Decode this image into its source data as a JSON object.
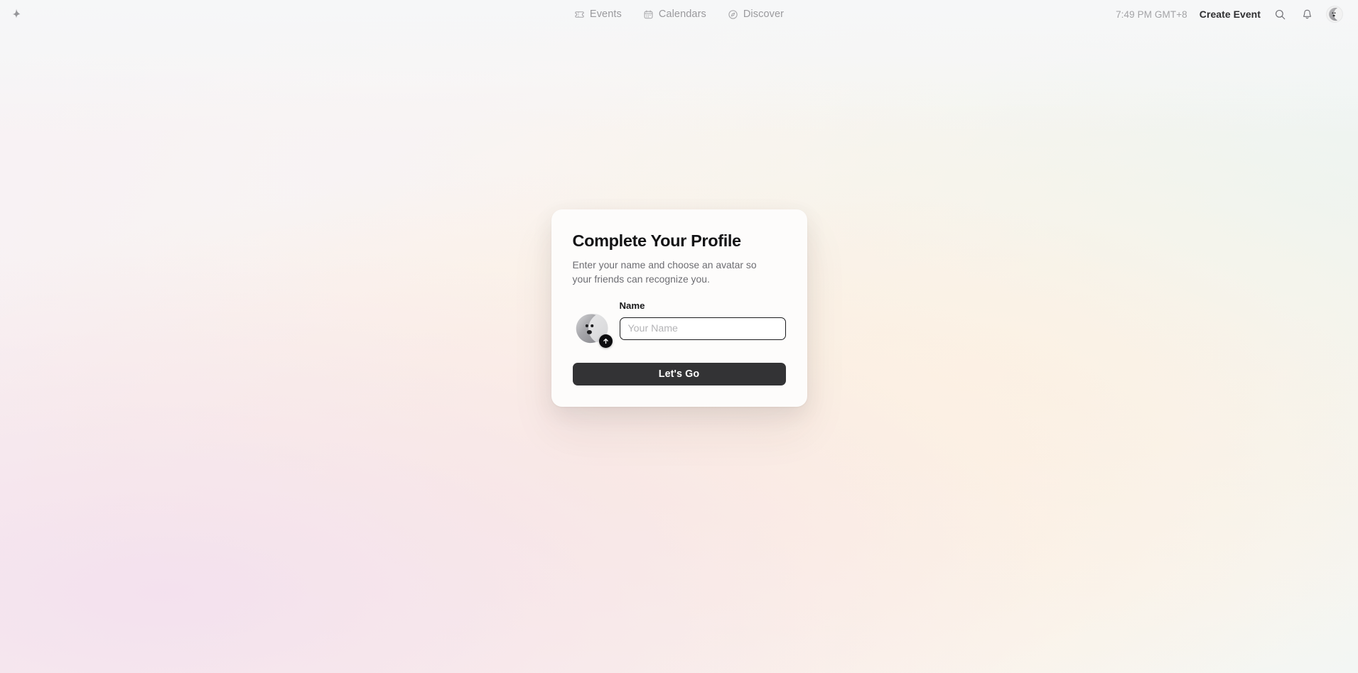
{
  "app": {
    "logo_icon": "sparkle-star-icon",
    "background_colors": {
      "pink": "#f3e0ee",
      "peach": "#fcece0",
      "cream": "#fdf3e4",
      "mint": "#e9f3f3",
      "base": "#fdfbfa"
    }
  },
  "topbar": {
    "nav_items": [
      {
        "label": "Events",
        "icon": "ticket-icon"
      },
      {
        "label": "Calendars",
        "icon": "calendar-icon"
      },
      {
        "label": "Discover",
        "icon": "compass-icon"
      }
    ],
    "time": "7:49 PM GMT+8",
    "create_event_label": "Create Event",
    "search_icon": "search-icon",
    "notifications_icon": "bell-icon",
    "avatar_icon": "user-avatar"
  },
  "modal": {
    "title": "Complete Your Profile",
    "subtitle": "Enter your name and choose an avatar so your friends can recognize you.",
    "avatar": {
      "icon": "avatar-placeholder",
      "upload_badge_icon": "arrow-up-icon"
    },
    "name_field": {
      "label": "Name",
      "value": "",
      "placeholder": "Your Name"
    },
    "submit_label": "Let's Go",
    "submit_color": "#333335"
  }
}
